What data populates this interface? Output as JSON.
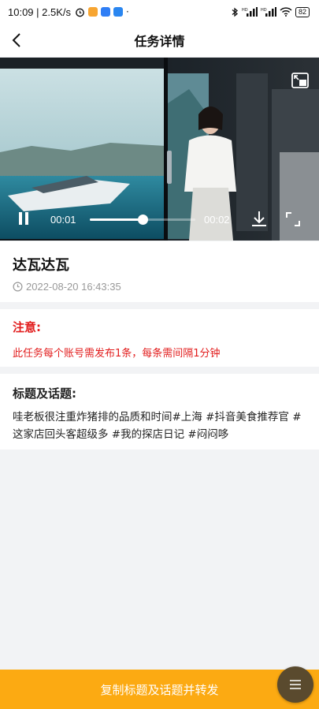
{
  "status_bar": {
    "time": "10:09",
    "network_speed": "2.5K/s",
    "battery": "82",
    "icons": [
      "alarm-icon",
      "app-icon-orange",
      "app-icon-blue",
      "app-icon-alipay",
      "bluetooth-icon",
      "signal-hd-icon",
      "signal-hd-icon",
      "wifi-icon",
      "battery-icon"
    ],
    "colors": {
      "app_orange": "#f7a531",
      "app_blue": "#2f7ef5",
      "app_blue2": "#2a86f0"
    }
  },
  "navbar": {
    "title": "任务详情",
    "back_icon": "chevron-left-icon"
  },
  "video": {
    "current_time": "00:01",
    "duration": "00:02",
    "progress": 0.5,
    "icons": [
      "picture-in-picture-icon",
      "pause-icon",
      "download-icon",
      "fullscreen-icon"
    ]
  },
  "task": {
    "name": "达瓦达瓦",
    "created_at": "2022-08-20 16:43:35",
    "clock_icon": "clock-icon"
  },
  "notice": {
    "title": "注意:",
    "text": "此任务每个账号需发布1条，每条需间隔1分钟",
    "color": "#e21d1d"
  },
  "topics": {
    "title": "标题及话题:",
    "text": "哇老板很注重炸猪排的品质和时间#上海 #抖音美食推荐官 #这家店回头客超级多 #我的探店日记 #闷闷哆"
  },
  "bottom": {
    "button_label": "复制标题及话题并转发",
    "button_color": "#fcaa12",
    "menu_icon": "menu-icon"
  }
}
